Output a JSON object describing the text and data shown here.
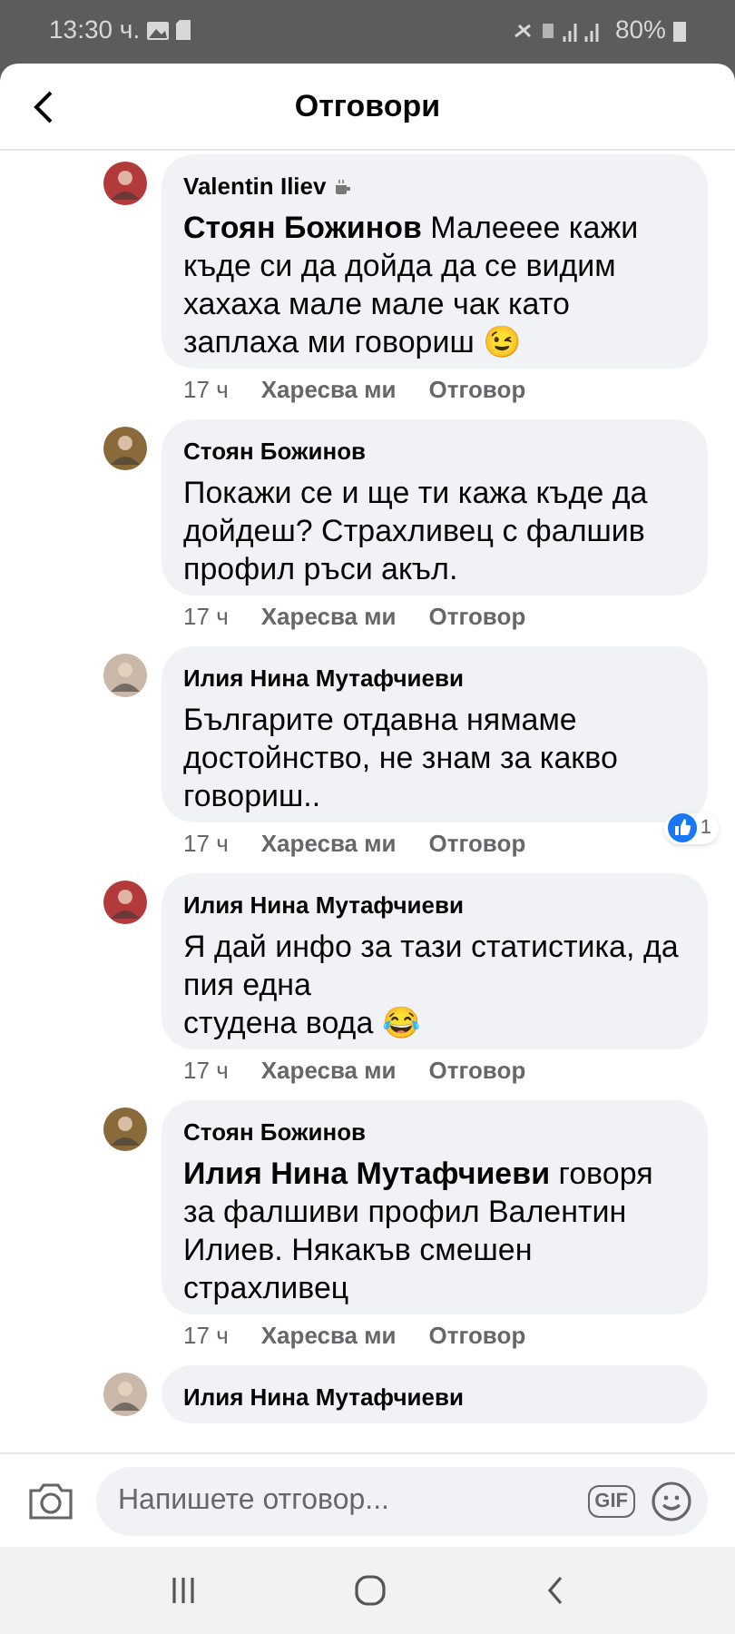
{
  "status_bar": {
    "time": "13:30 ч.",
    "battery": "80%"
  },
  "header": {
    "title": "Отговори"
  },
  "comments": [
    {
      "author": "Valentin Iliev",
      "top_fan_badge": true,
      "body": "**Стоян Божинов** Малееее кажи къде си да дойда да се видим хахаха мале мале чак като заплаха ми говориш 😉",
      "time": "17 ч",
      "like": "Харесва ми",
      "reply": "Отговор"
    },
    {
      "author": "Стоян Божинов",
      "top_fan_badge": false,
      "body": "Покажи се и ще ти кажа къде да дойдеш? Страхливец с фалшив профил ръси акъл.",
      "time": "17 ч",
      "like": "Харесва ми",
      "reply": "Отговор"
    },
    {
      "author": "Илия Нина Мутафчиеви",
      "top_fan_badge": false,
      "body": "Българите отдавна нямаме достойнство, не знам за какво говориш..",
      "time": "17 ч",
      "like": "Харесва ми",
      "reply": "Отговор",
      "reactions": "1"
    },
    {
      "author": "Илия Нина Мутафчиеви",
      "top_fan_badge": false,
      "body": "Я дай инфо за тази статистика, да пия една\nстудена вода 😂",
      "time": "17 ч",
      "like": "Харесва ми",
      "reply": "Отговор"
    },
    {
      "author": "Стоян Божинов",
      "top_fan_badge": false,
      "body": "**Илия Нина Мутафчиеви** говоря за фалшиви профил Валентин Илиев. Някакъв смешен страхливец",
      "time": "17 ч",
      "like": "Харесва ми",
      "reply": "Отговор"
    },
    {
      "author": "Илия Нина Мутафчиеви",
      "top_fan_badge": false
    }
  ],
  "composer": {
    "placeholder": "Напишете отговор...",
    "gif": "GIF"
  }
}
